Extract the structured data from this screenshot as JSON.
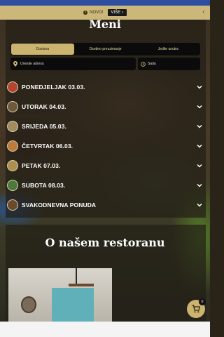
{
  "notice": {
    "icon": "info-icon",
    "text": "NOVO!",
    "more_label": "VIŠE ›",
    "close_label": "‹"
  },
  "menu": {
    "title": "Meni",
    "tabs": [
      {
        "label": "Dostava",
        "active": true
      },
      {
        "label": "Osobno preuzimanje",
        "active": false
      },
      {
        "label": "Jedite unutra",
        "active": false
      }
    ],
    "address_placeholder": "Unesite adresu",
    "time_value": "Sada",
    "days": [
      {
        "label": "PONEDJELJAK 03.03.",
        "dish_color": "#b5452f"
      },
      {
        "label": "UTORAK 04.03.",
        "dish_color": "#6e5a3b"
      },
      {
        "label": "SRIJEDA 05.03.",
        "dish_color": "#a58c5e"
      },
      {
        "label": "ČETVRTAK 06.03.",
        "dish_color": "#c07a3a"
      },
      {
        "label": "PETAK 07.03.",
        "dish_color": "#b08f4e"
      },
      {
        "label": "SUBOTA 08.03.",
        "dish_color": "#4d7a3a"
      },
      {
        "label": "SVAKODNEVNA PONUDA",
        "dish_color": "#6b4a2a"
      }
    ]
  },
  "about": {
    "title": "O našem restoranu"
  },
  "cart": {
    "count": "0"
  },
  "colors": {
    "accent": "#cbb46f",
    "notice_bg": "#ccb77a",
    "top_bar": "#2f4ea0"
  }
}
